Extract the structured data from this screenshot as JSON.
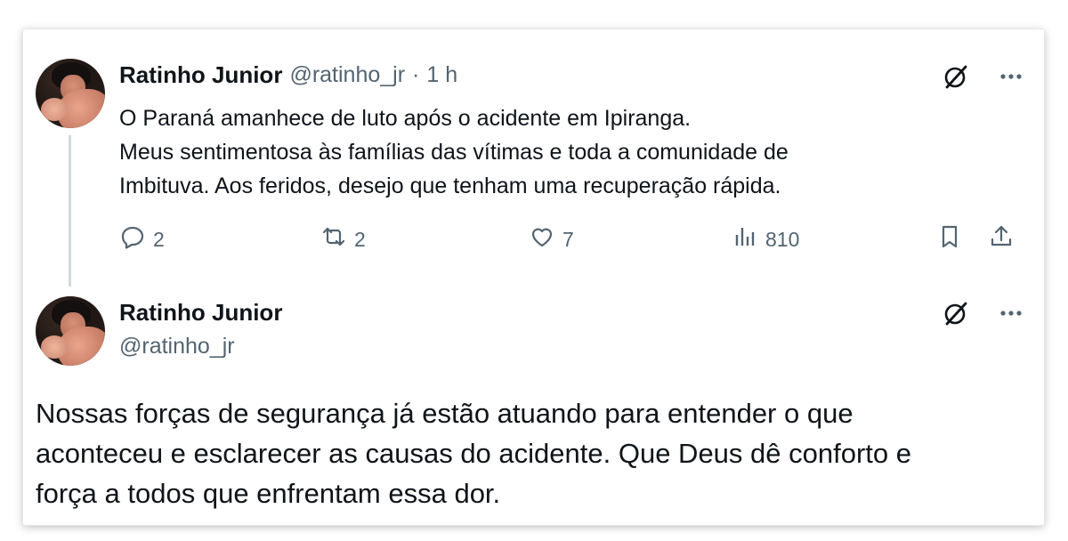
{
  "tweet1": {
    "name": "Ratinho Junior",
    "handle": "@ratinho_jr",
    "separator": "·",
    "time": "1 h",
    "text_lines": [
      "O Paraná amanhece de luto após o acidente em Ipiranga.",
      "Meus sentimentosa às famílias das vítimas e toda a comunidade de",
      "Imbituva. Aos feridos, desejo que tenham uma recuperação rápida."
    ],
    "actions": {
      "replies": "2",
      "reposts": "2",
      "likes": "7",
      "views": "810"
    }
  },
  "tweet2": {
    "name": "Ratinho Junior",
    "handle": "@ratinho_jr",
    "text_lines": [
      "Nossas forças de segurança já estão atuando para entender o que",
      "aconteceu e esclarecer as causas do acidente. Que Deus dê conforto e",
      "força a todos que enfrentam essa dor."
    ]
  },
  "icons": {
    "grok": "grok-icon",
    "more": "more-icon",
    "reply": "reply-icon",
    "repost": "repost-icon",
    "like": "heart-icon",
    "views": "views-icon",
    "bookmark": "bookmark-icon",
    "share": "share-icon"
  },
  "colors": {
    "text": "#0f1419",
    "secondary": "#536471",
    "thread_line": "#cfd9de"
  }
}
